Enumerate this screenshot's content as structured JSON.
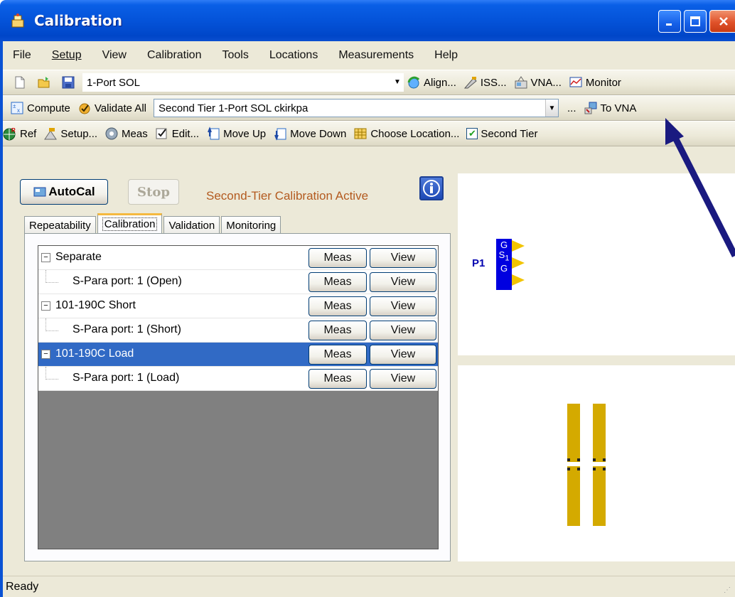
{
  "window": {
    "title": "Calibration"
  },
  "menu": [
    "File",
    "Setup",
    "View",
    "Calibration",
    "Tools",
    "Locations",
    "Measurements",
    "Help"
  ],
  "toolbar1": {
    "config": "1-Port SOL",
    "align": "Align...",
    "iss": "ISS...",
    "vna": "VNA...",
    "monitor": "Monitor"
  },
  "toolbar2": {
    "compute": "Compute",
    "validate_all": "Validate All",
    "cal_select": "Second Tier 1-Port SOL ckirkpa",
    "ellipsis": "...",
    "to_vna": "To VNA"
  },
  "toolbar3": {
    "ref": "Ref",
    "setup": "Setup...",
    "meas": "Meas",
    "edit": "Edit...",
    "move_up": "Move Up",
    "move_down": "Move Down",
    "choose_location": "Choose Location...",
    "second_tier": "Second Tier"
  },
  "panel": {
    "autocal": "AutoCal",
    "stop": "Stop",
    "status_label": "Second-Tier Calibration Active"
  },
  "tabs": [
    "Repeatability",
    "Calibration",
    "Validation",
    "Monitoring"
  ],
  "grid": {
    "rows": [
      {
        "label": "Separate",
        "meas": "Meas",
        "view": "View"
      },
      {
        "label": "S-Para port: 1 (Open)",
        "meas": "Meas",
        "view": "View"
      },
      {
        "label": "101-190C Short",
        "meas": "Meas",
        "view": "View"
      },
      {
        "label": "S-Para port: 1 (Short)",
        "meas": "Meas",
        "view": "View"
      },
      {
        "label": "101-190C Load",
        "meas": "Meas",
        "view": "View"
      },
      {
        "label": "S-Para port: 1 (Load)",
        "meas": "Meas",
        "view": "View"
      }
    ]
  },
  "probe": {
    "name": "P1",
    "pins": [
      "G",
      "S",
      "G"
    ],
    "subscript": "1"
  },
  "status": {
    "text": "Ready"
  },
  "colors": {
    "titlebar": "#0453d9",
    "selection": "#316ac5",
    "probe": "#0000e0",
    "pads": "#d4aa00",
    "annotation_arrow": "#1a1a80"
  }
}
